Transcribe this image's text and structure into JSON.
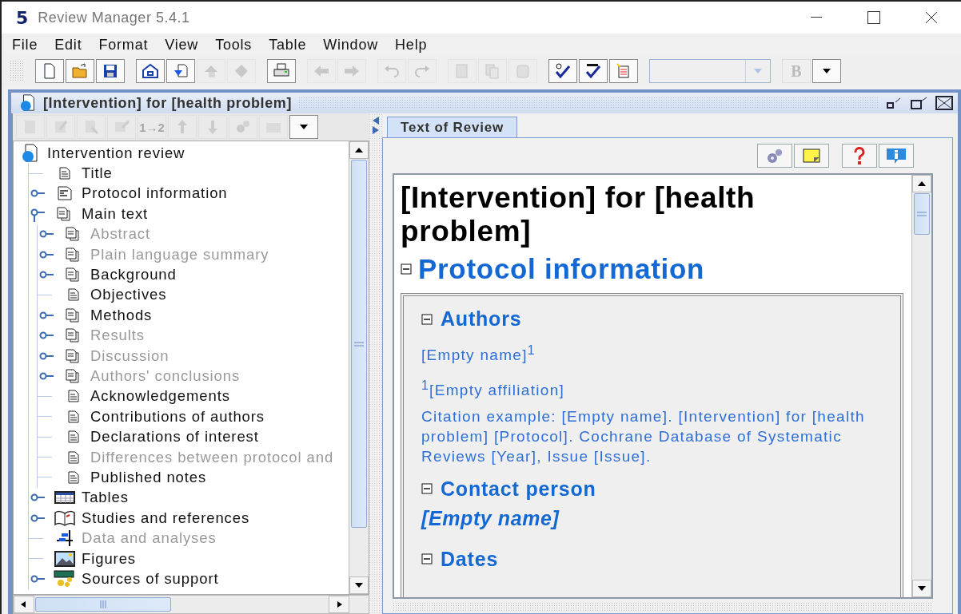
{
  "window": {
    "logo": "5",
    "title": "Review Manager 5.4.1"
  },
  "menu": [
    "File",
    "Edit",
    "Format",
    "View",
    "Tools",
    "Table",
    "Window",
    "Help"
  ],
  "toolbar": {
    "groups": [
      [
        {
          "disabled": false
        },
        {
          "disabled": false
        },
        {
          "disabled": false
        }
      ],
      [
        {
          "disabled": false
        },
        {
          "disabled": false
        },
        {
          "disabled": true
        },
        {
          "disabled": true
        }
      ],
      [
        {
          "disabled": false
        }
      ],
      [
        {
          "disabled": true
        },
        {
          "disabled": true
        }
      ],
      [
        {
          "disabled": true
        },
        {
          "disabled": true
        }
      ],
      [
        {
          "disabled": true
        },
        {
          "disabled": true
        },
        {
          "disabled": true
        }
      ],
      [
        {
          "disabled": false
        },
        {
          "disabled": false
        },
        {
          "disabled": false
        }
      ]
    ],
    "font_combo": {
      "disabled": true
    },
    "bold": {
      "label": "B",
      "disabled": true
    }
  },
  "document": {
    "title": "[Intervention] for [health problem]"
  },
  "outline_toolbar": {
    "buttons": [
      {
        "disabled": true
      },
      {
        "disabled": true
      },
      {
        "disabled": true
      },
      {
        "disabled": true
      },
      {
        "label": "1→2",
        "disabled": true
      },
      {
        "disabled": true
      },
      {
        "disabled": true
      },
      {
        "disabled": true
      },
      {
        "disabled": true
      }
    ]
  },
  "tree": {
    "label": "Intervention review",
    "kind": "review",
    "children": [
      {
        "label": "Title",
        "kind": "page",
        "dimmed": false
      },
      {
        "label": "Protocol information",
        "kind": "form",
        "dimmed": false,
        "expanded": false
      },
      {
        "label": "Main text",
        "kind": "pages",
        "dimmed": false,
        "expanded": true,
        "children": [
          {
            "label": "Abstract",
            "kind": "pages",
            "dimmed": true,
            "expanded": false
          },
          {
            "label": "Plain language summary",
            "kind": "pages",
            "dimmed": true,
            "expanded": false
          },
          {
            "label": "Background",
            "kind": "pages",
            "dimmed": false,
            "expanded": false
          },
          {
            "label": "Objectives",
            "kind": "page",
            "dimmed": false
          },
          {
            "label": "Methods",
            "kind": "pages",
            "dimmed": false,
            "expanded": false
          },
          {
            "label": "Results",
            "kind": "pages",
            "dimmed": true,
            "expanded": false
          },
          {
            "label": "Discussion",
            "kind": "pages",
            "dimmed": true,
            "expanded": false
          },
          {
            "label": "Authors' conclusions",
            "kind": "pages",
            "dimmed": true,
            "expanded": false
          },
          {
            "label": "Acknowledgements",
            "kind": "page",
            "dimmed": false
          },
          {
            "label": "Contributions of authors",
            "kind": "page",
            "dimmed": false
          },
          {
            "label": "Declarations of interest",
            "kind": "page",
            "dimmed": false
          },
          {
            "label": "Differences between protocol and",
            "kind": "page",
            "dimmed": true
          },
          {
            "label": "Published notes",
            "kind": "page",
            "dimmed": false
          }
        ]
      },
      {
        "label": "Tables",
        "kind": "table",
        "dimmed": false,
        "expanded": false
      },
      {
        "label": "Studies and references",
        "kind": "book",
        "dimmed": false,
        "expanded": false
      },
      {
        "label": "Data and analyses",
        "kind": "data",
        "dimmed": true
      },
      {
        "label": "Figures",
        "kind": "image",
        "dimmed": false
      },
      {
        "label": "Sources of support",
        "kind": "support",
        "dimmed": false,
        "expanded": false
      }
    ]
  },
  "tabs": [
    {
      "label": "Text of Review",
      "selected": true
    }
  ],
  "review": {
    "title": "[Intervention] for [health problem]",
    "section": {
      "heading": "Protocol information",
      "expanded": true
    },
    "subsections": [
      {
        "kind": "authors",
        "heading": "Authors",
        "expanded": true,
        "author": "[Empty name]$^{1}$",
        "affiliation": "$^{1}$[Empty affiliation]",
        "citation": "Citation example: [Empty name]. [Intervention] for [health problem] [Protocol]. Cochrane Database of Systematic Reviews [Year], Issue [Issue]."
      },
      {
        "kind": "contact",
        "heading": "Contact person",
        "expanded": true,
        "name": "[Empty name]"
      },
      {
        "kind": "dates",
        "heading": "Dates",
        "expanded": true
      }
    ]
  }
}
